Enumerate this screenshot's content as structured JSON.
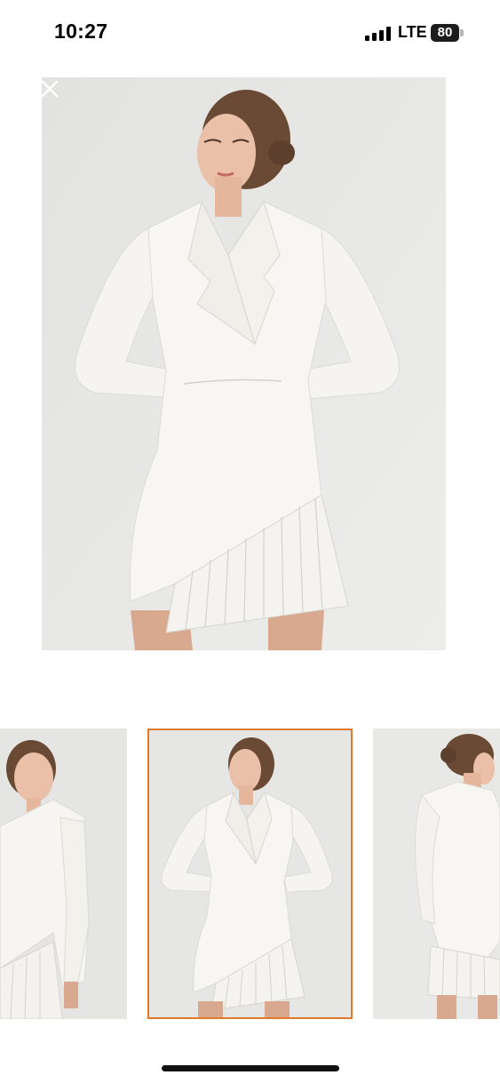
{
  "status_bar": {
    "time": "10:27",
    "network": "LTE",
    "battery": "80"
  },
  "gallery": {
    "main_image_alt": "product-photo",
    "selected_index": 1,
    "accent_color": "#e07a2a",
    "close_icon": "close-icon",
    "thumbnails": [
      {
        "view": "side"
      },
      {
        "view": "front"
      },
      {
        "view": "back"
      }
    ]
  }
}
